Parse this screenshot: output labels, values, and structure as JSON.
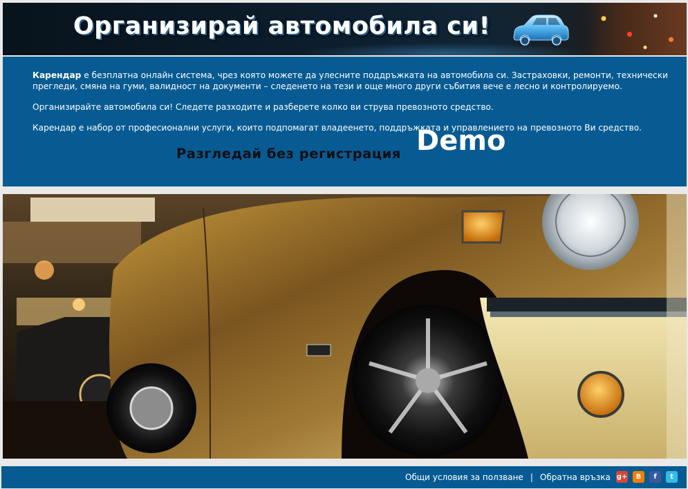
{
  "header": {
    "title": "Организирай автомобила си!",
    "logo_icon": "car-icon"
  },
  "intro": {
    "brand": "Карендар",
    "paragraph1_rest": " е безплатна онлайн система, чрез която можете да улесните поддръжката на автомобила си. Застраховки, ремонти, технически прегледи, смяна на гуми, валидност на документи – следенето на тези и още много други събития вече е лесно и контролируемо.",
    "paragraph2": "Организирайте автомобила си! Следете разходите и разберете колко ви струва превозното средство.",
    "paragraph3": "Карендар е набор от професионални услуги, които подпомагат владеенето, поддръжката и управлението на превозното Ви средство.",
    "demo_text": "Разгледай без регистрация",
    "demo_label": "Demo"
  },
  "hero": {
    "image_icon": "car-photo"
  },
  "footer": {
    "terms": "Общи условия за ползване",
    "separator": "|",
    "feedback": "Обратна връзка",
    "social": [
      {
        "icon": "google-plus-icon",
        "glyph": "g+"
      },
      {
        "icon": "blogger-icon",
        "glyph": "B"
      },
      {
        "icon": "facebook-icon",
        "glyph": "f"
      },
      {
        "icon": "twitter-icon",
        "glyph": "t"
      }
    ]
  },
  "colors": {
    "panel_blue": "#085b92",
    "page_bg": "#e9e9e9"
  }
}
